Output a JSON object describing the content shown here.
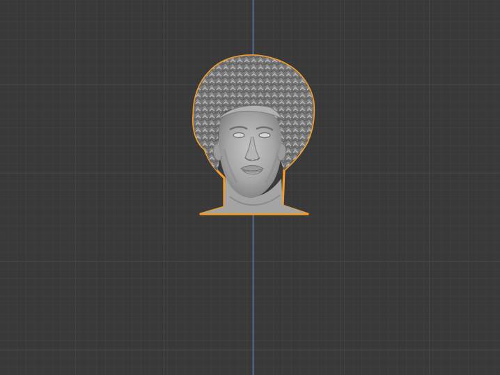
{
  "viewport": {
    "mode": "3d-viewport",
    "background_color": "#393939",
    "grid": {
      "minor_color": "#444444",
      "major_color": "#4f4f4f",
      "axis_color": "#5f84c4"
    },
    "object": {
      "name": "",
      "selected": true,
      "selection_outline_color": "#f39c2a",
      "mesh_color": "#a9a9a9"
    }
  }
}
